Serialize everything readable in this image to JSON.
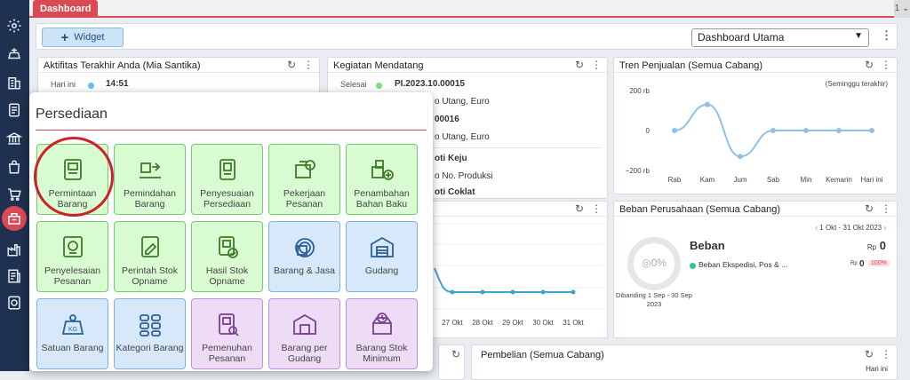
{
  "topbar": {
    "tab": "Dashboard",
    "right_glyph": "1"
  },
  "toolbar": {
    "widget_label": "Widget",
    "select_value": "Dashboard Utama"
  },
  "aktifitas": {
    "title": "Aktifitas Terakhir Anda (Mia Santika)",
    "row_label": "Hari ini",
    "row_time": "14:51"
  },
  "kegiatan": {
    "title": "Kegiatan Mendatang",
    "status": "Selesai",
    "code": "PI.2023.10.00015",
    "lines": [
      "o Utang, Euro",
      "00016",
      "o Utang, Euro",
      "oti Keju",
      "o No. Produksi",
      "oti Coklat"
    ]
  },
  "tren": {
    "title": "Tren Penjualan (Semua Cabang)",
    "subtitle": "(Seminggu terakhir)"
  },
  "middle_chart": {
    "x_labels": [
      "27 Okt",
      "28 Okt",
      "29 Okt",
      "30 Okt",
      "31 Okt"
    ]
  },
  "beban": {
    "title": "Beban Perusahaan (Semua Cabang)",
    "range": "1 Okt - 31 Okt 2023",
    "heading": "Beban",
    "currency": "Rp",
    "total": "0",
    "gauge_value": "0%",
    "compare_text": "Dibanding 1 Sep - 30 Sep 2023",
    "item_label": "Beban Ekspedisi, Pos & ...",
    "item_currency": "Rp",
    "item_value": "0",
    "item_pct": "100%"
  },
  "pembelian": {
    "title": "Pembelian (Semua Cabang)",
    "right": "Hari ini"
  },
  "persediaan": {
    "title": "Persediaan",
    "tiles": [
      {
        "label": "Permintaan Barang"
      },
      {
        "label": "Pemindahan Barang"
      },
      {
        "label": "Penyesuaian Persediaan"
      },
      {
        "label": "Pekerjaan Pesanan"
      },
      {
        "label": "Penambahan Bahan Baku"
      },
      {
        "label": "Penyelesaian Pesanan"
      },
      {
        "label": "Perintah Stok Opname"
      },
      {
        "label": "Hasil Stok Opname"
      },
      {
        "label": "Barang & Jasa"
      },
      {
        "label": "Gudang"
      },
      {
        "label": "Satuan Barang"
      },
      {
        "label": "Kategori Barang"
      },
      {
        "label": "Pemenuhan Pesanan"
      },
      {
        "label": "Barang per Gudang"
      },
      {
        "label": "Barang Stok Minimum"
      }
    ]
  },
  "chart_data": {
    "type": "line",
    "title": "Tren Penjualan (Semua Cabang)",
    "subtitle": "(Seminggu terakhir)",
    "categories": [
      "Rab",
      "Kam",
      "Jum",
      "Sab",
      "Min",
      "Kemarin",
      "Hari ini"
    ],
    "values": [
      0,
      130,
      -130,
      0,
      0,
      0,
      0
    ],
    "y_ticks": [
      "200 rb",
      "0",
      "−200 rb"
    ],
    "ylim": [
      -200,
      200
    ],
    "color": "#8fc1e8"
  },
  "colors": {
    "accent": "#d94a54",
    "sidebar": "#1f3150"
  }
}
